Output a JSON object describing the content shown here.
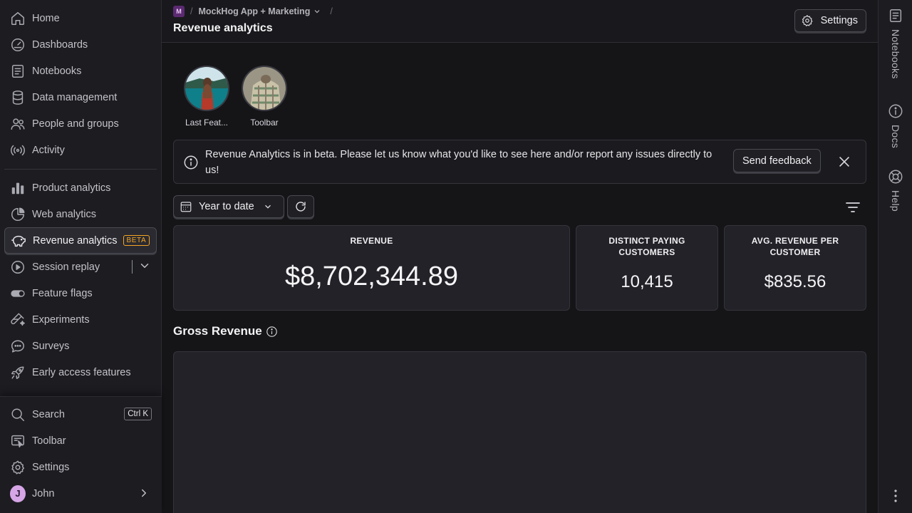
{
  "sidebar": {
    "items": [
      {
        "label": "Home",
        "icon": "home-icon"
      },
      {
        "label": "Dashboards",
        "icon": "gauge-icon"
      },
      {
        "label": "Notebooks",
        "icon": "notebook-icon"
      },
      {
        "label": "Data management",
        "icon": "database-icon"
      },
      {
        "label": "People and groups",
        "icon": "people-icon"
      },
      {
        "label": "Activity",
        "icon": "broadcast-icon"
      }
    ],
    "products": [
      {
        "label": "Product analytics",
        "icon": "bar-chart-icon"
      },
      {
        "label": "Web analytics",
        "icon": "pie-chart-icon"
      },
      {
        "label": "Revenue analytics",
        "icon": "piggy-bank-icon",
        "badge": "BETA"
      },
      {
        "label": "Session replay",
        "icon": "play-circle-icon"
      },
      {
        "label": "Feature flags",
        "icon": "toggle-icon"
      },
      {
        "label": "Experiments",
        "icon": "flask-icon"
      },
      {
        "label": "Surveys",
        "icon": "chat-bubble-icon"
      },
      {
        "label": "Early access features",
        "icon": "rocket-icon"
      }
    ],
    "bottom": {
      "search_label": "Search",
      "search_shortcut": "Ctrl K",
      "toolbar_label": "Toolbar",
      "settings_label": "Settings",
      "user_name": "John",
      "user_initial": "J"
    }
  },
  "header": {
    "project_badge": "M",
    "project_name": "MockHog App + Marketing",
    "page_title": "Revenue analytics",
    "settings_label": "Settings"
  },
  "stories": [
    {
      "label": "Last Feat..."
    },
    {
      "label": "Toolbar"
    }
  ],
  "banner": {
    "text": "Revenue Analytics is in beta. Please let us know what you'd like to see here and/or report any issues directly to us!",
    "feedback_label": "Send feedback"
  },
  "filters": {
    "date_range": "Year to date"
  },
  "metrics": [
    {
      "title": "REVENUE",
      "value": "$8,702,344.89"
    },
    {
      "title": "DISTINCT PAYING CUSTOMERS",
      "value": "10,415"
    },
    {
      "title": "AVG. REVENUE PER CUSTOMER",
      "value": "$835.56"
    }
  ],
  "gross_revenue": {
    "title": "Gross Revenue"
  },
  "rightbar": {
    "notebooks_label": "Notebooks",
    "docs_label": "Docs",
    "help_label": "Help"
  },
  "colors": {
    "accent_beta": "#f5a524",
    "background": "#151518",
    "sidebar": "#1c1c21",
    "card": "#222228"
  }
}
